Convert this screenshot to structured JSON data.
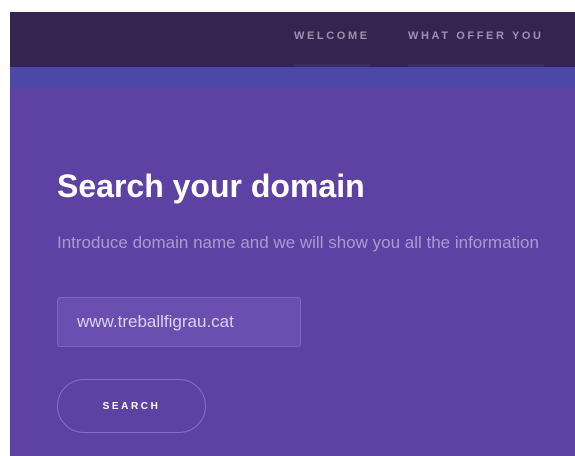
{
  "nav": {
    "links": [
      {
        "label": "WELCOME"
      },
      {
        "label": "WHAT OFFER YOU"
      }
    ]
  },
  "hero": {
    "title": "Search your domain",
    "subtitle": "Introduce domain name and we will show you all the information"
  },
  "search": {
    "input_value": "www.treballfigrau.cat",
    "button_label": "SEARCH"
  },
  "colors": {
    "navbar": "#35244f",
    "accent_strip": "#4d47a8",
    "background": "#5e42a3",
    "subtitle_text": "#a99bd0"
  }
}
